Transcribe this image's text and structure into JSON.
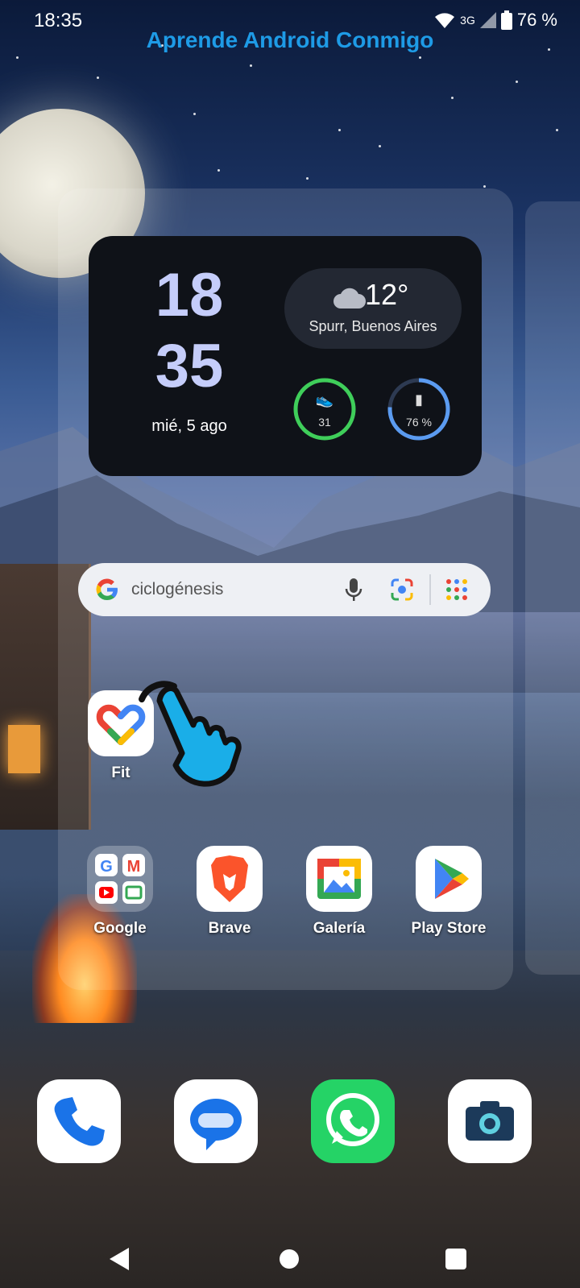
{
  "status_bar": {
    "time": "18:35",
    "network": "3G",
    "battery": "76 %"
  },
  "banner": {
    "title": "Aprende Android Conmigo"
  },
  "clock_widget": {
    "hour": "18",
    "minute": "35",
    "date": "mié, 5 ago",
    "temperature": "12°",
    "location": "Spurr, Buenos Aires",
    "steps_value": "31",
    "battery_value": "76 %",
    "battery_level": 0.76,
    "ring_colors": {
      "steps": "#3fce5a",
      "battery": "#5b9bf0"
    }
  },
  "search_bar": {
    "query": "ciclogénesis"
  },
  "apps": {
    "fit": "Fit",
    "google": "Google",
    "brave": "Brave",
    "galeria": "Galería",
    "play_store": "Play Store"
  },
  "dock": {
    "icons": [
      "phone-icon",
      "messages-icon",
      "whatsapp-icon",
      "camera-icon"
    ]
  }
}
